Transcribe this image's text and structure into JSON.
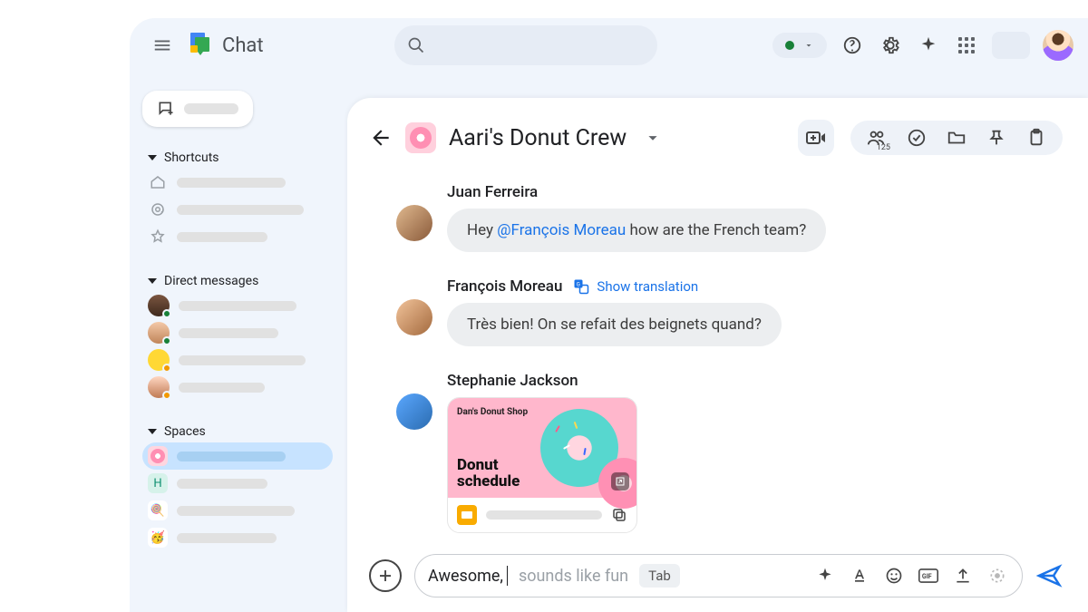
{
  "app": {
    "title": "Chat"
  },
  "sidebar": {
    "sections": {
      "shortcuts": "Shortcuts",
      "direct": "Direct messages",
      "spaces": "Spaces"
    },
    "sq_h_label": "H"
  },
  "topactions": {
    "member_count": "125"
  },
  "space": {
    "title": "Aari's Donut Crew"
  },
  "messages": [
    {
      "author": "Juan Ferreira",
      "prefix": "Hey ",
      "mention": "@François Moreau",
      "suffix": " how are the French team?"
    },
    {
      "author": "François Moreau",
      "translate_label": "Show translation",
      "text": "Très bien! On se refait des beignets quand?"
    },
    {
      "author": "Stephanie Jackson",
      "card": {
        "shop": "Dan's Donut Shop",
        "title_l1": "Donut",
        "title_l2": "schedule"
      }
    }
  ],
  "composer": {
    "typed": "Awesome,",
    "suggestion": "sounds like fun",
    "tab_key": "Tab"
  }
}
